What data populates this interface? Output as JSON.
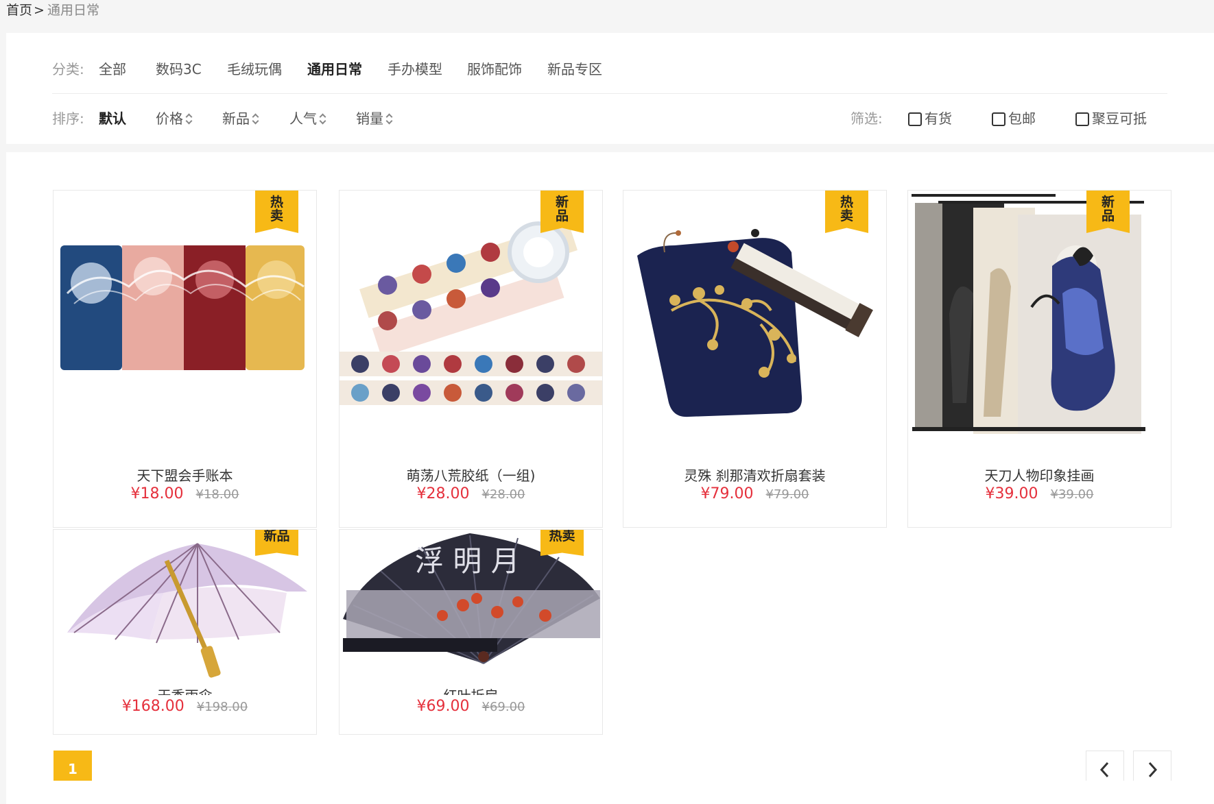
{
  "breadcrumb": {
    "home": "首页",
    "separator": ">",
    "current": "通用日常"
  },
  "category": {
    "label": "分类:",
    "items": [
      "全部",
      "数码3C",
      "毛绒玩偶",
      "通用日常",
      "手办模型",
      "服饰配饰",
      "新品专区"
    ],
    "active_index": 3
  },
  "sort": {
    "label": "排序:",
    "items": [
      "默认",
      "价格",
      "新品",
      "人气",
      "销量"
    ],
    "active_index": 0
  },
  "filter": {
    "label": "筛选:",
    "options": [
      {
        "label": "有货",
        "checked": false
      },
      {
        "label": "包邮",
        "checked": false
      },
      {
        "label": "聚豆可抵",
        "checked": false
      }
    ]
  },
  "products": [
    {
      "name": "天下盟会手账本",
      "price": "¥18.00",
      "original_price": "¥18.00",
      "badge": "热卖"
    },
    {
      "name": "萌荡八荒胶纸（一组)",
      "price": "¥28.00",
      "original_price": "¥28.00",
      "badge": "新品"
    },
    {
      "name": "灵殊 刹那清欢折扇套装",
      "price": "¥79.00",
      "original_price": "¥79.00",
      "badge": "热卖"
    },
    {
      "name": "天刀人物印象挂画",
      "price": "¥39.00",
      "original_price": "¥39.00",
      "badge": "新品"
    },
    {
      "name": "天香雨伞",
      "price": "¥168.00",
      "original_price": "¥198.00",
      "badge": "新品"
    },
    {
      "name": "红叶折扇",
      "price": "¥69.00",
      "original_price": "¥69.00",
      "badge": "热卖"
    }
  ],
  "pagination": {
    "current": "1"
  },
  "colors": {
    "accent": "#f7b916",
    "price": "#e5303c",
    "muted": "#999999"
  }
}
